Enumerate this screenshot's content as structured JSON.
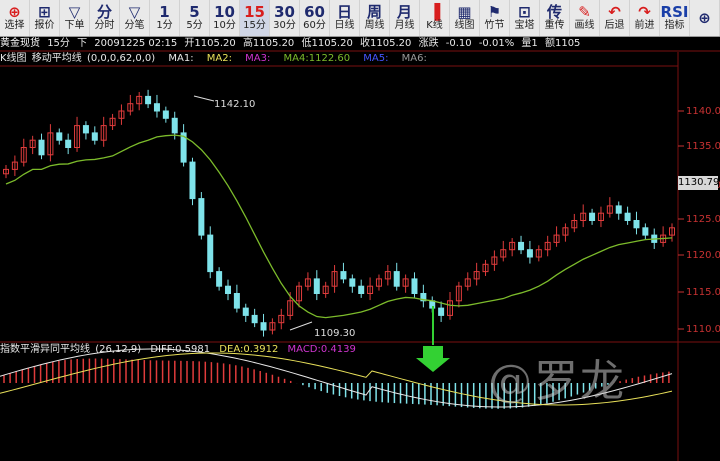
{
  "toolbar": {
    "buttons": [
      {
        "top": "⊕",
        "bottom": "选择",
        "color": "red"
      },
      {
        "top": "⊞",
        "bottom": "报价",
        "color": "dark"
      },
      {
        "top": "▽",
        "bottom": "下单",
        "color": "dark"
      },
      {
        "top": "分",
        "bottom": "分时",
        "color": "dark"
      },
      {
        "top": "▽",
        "bottom": "分笔",
        "color": "dark"
      },
      {
        "top": "1",
        "bottom": "1分",
        "color": "dark"
      },
      {
        "top": "5",
        "bottom": "5分",
        "color": "dark"
      },
      {
        "top": "10",
        "bottom": "10分",
        "color": "dark"
      },
      {
        "top": "15",
        "bottom": "15分",
        "color": "red",
        "active": true
      },
      {
        "top": "30",
        "bottom": "30分",
        "color": "dark"
      },
      {
        "top": "60",
        "bottom": "60分",
        "color": "dark"
      },
      {
        "top": "日",
        "bottom": "日线",
        "color": "dark"
      },
      {
        "top": "周",
        "bottom": "周线",
        "color": "dark"
      },
      {
        "top": "月",
        "bottom": "月线",
        "color": "dark"
      },
      {
        "top": "▐",
        "bottom": "K线",
        "color": "red"
      },
      {
        "top": "▦",
        "bottom": "线图",
        "color": "dark"
      },
      {
        "top": "⚑",
        "bottom": "竹节",
        "color": "dark"
      },
      {
        "top": "⊡",
        "bottom": "宝塔",
        "color": "dark"
      },
      {
        "top": "传",
        "bottom": "重传",
        "color": "dark"
      },
      {
        "top": "✎",
        "bottom": "画线",
        "color": "red"
      },
      {
        "top": "↶",
        "bottom": "后退",
        "color": "red"
      },
      {
        "top": "↷",
        "bottom": "前进",
        "color": "red"
      },
      {
        "top": "RSI",
        "bottom": "指标",
        "color": "blue"
      },
      {
        "top": "⊕",
        "bottom": "",
        "color": "dark"
      }
    ]
  },
  "infobar": {
    "symbol": "黄金现货",
    "period": "15分",
    "direction": "下",
    "datetime": "20091225 02:15",
    "open": "开1105.20",
    "high": "高1105.20",
    "low": "低1105.20",
    "close": "收1105.20",
    "change_label": "涨跌",
    "change": "-0.10",
    "change_pct": "-0.01%",
    "volume": "量1",
    "amount": "额1105"
  },
  "ma_bar": {
    "label": "K线图",
    "indicator": "移动平均线",
    "params": "(0,0,0,62,0,0)",
    "ma1": "MA1:",
    "ma2": "MA2:",
    "ma3": "MA3:",
    "ma4": "MA4:1122.60",
    "ma5": "MA5:",
    "ma6": "MA6:"
  },
  "macd_bar": {
    "indicator": "指数平滑异同平均线",
    "params": "(26,12,9)",
    "diff": "DIFF:0.5981",
    "dea": "DEA:0.3912",
    "macd": "MACD:0.4139"
  },
  "price_annotations": {
    "high_label": "1142.10",
    "low_label": "1109.30",
    "current_price": "1130.79"
  },
  "axis_labels": [
    "1140.00",
    "1135.00",
    "1130.00",
    "1125.00",
    "1120.00",
    "1115.00",
    "1110.00"
  ],
  "colors": {
    "up": "#e03c3c",
    "down": "#7fe3ea",
    "ma_line": "#7cbb2b",
    "diff_line": "#e9e9e9",
    "dea_line": "#e8e05a",
    "grid": "#7a1010",
    "arrow": "#33d133"
  },
  "watermark": "@罗龙"
}
